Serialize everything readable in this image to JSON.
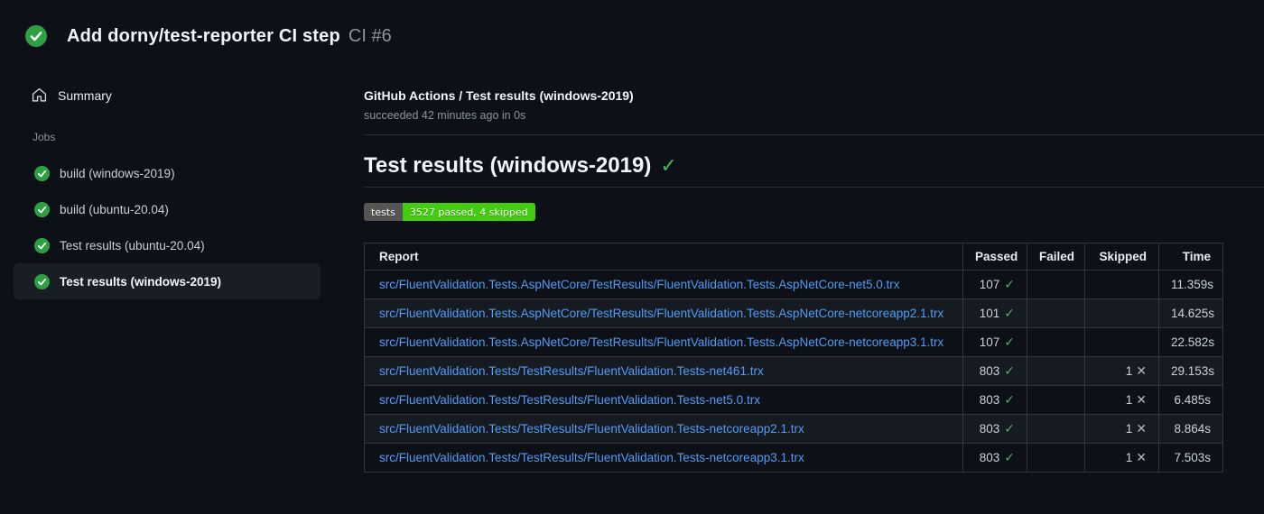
{
  "header": {
    "title": "Add dorny/test-reporter CI step",
    "run_label": "CI #6"
  },
  "sidebar": {
    "summary_label": "Summary",
    "jobs_section_label": "Jobs",
    "jobs": [
      {
        "label": "build (windows-2019)",
        "selected": false
      },
      {
        "label": "build (ubuntu-20.04)",
        "selected": false
      },
      {
        "label": "Test results (ubuntu-20.04)",
        "selected": false
      },
      {
        "label": "Test results (windows-2019)",
        "selected": true
      }
    ]
  },
  "main": {
    "job_title": "GitHub Actions / Test results (windows-2019)",
    "status_line": "succeeded 42 minutes ago in 0s",
    "heading": "Test results (windows-2019)",
    "badge": {
      "label": "tests",
      "value": "3527 passed, 4 skipped"
    },
    "table": {
      "headers": [
        "Report",
        "Passed",
        "Failed",
        "Skipped",
        "Time"
      ],
      "rows": [
        {
          "report": "src/FluentValidation.Tests.AspNetCore/TestResults/FluentValidation.Tests.AspNetCore-net5.0.trx",
          "passed": "107",
          "failed": "",
          "skipped": "",
          "time": "11.359s"
        },
        {
          "report": "src/FluentValidation.Tests.AspNetCore/TestResults/FluentValidation.Tests.AspNetCore-netcoreapp2.1.trx",
          "passed": "101",
          "failed": "",
          "skipped": "",
          "time": "14.625s"
        },
        {
          "report": "src/FluentValidation.Tests.AspNetCore/TestResults/FluentValidation.Tests.AspNetCore-netcoreapp3.1.trx",
          "passed": "107",
          "failed": "",
          "skipped": "",
          "time": "22.582s"
        },
        {
          "report": "src/FluentValidation.Tests/TestResults/FluentValidation.Tests-net461.trx",
          "passed": "803",
          "failed": "",
          "skipped": "1",
          "time": "29.153s"
        },
        {
          "report": "src/FluentValidation.Tests/TestResults/FluentValidation.Tests-net5.0.trx",
          "passed": "803",
          "failed": "",
          "skipped": "1",
          "time": "6.485s"
        },
        {
          "report": "src/FluentValidation.Tests/TestResults/FluentValidation.Tests-netcoreapp2.1.trx",
          "passed": "803",
          "failed": "",
          "skipped": "1",
          "time": "8.864s"
        },
        {
          "report": "src/FluentValidation.Tests/TestResults/FluentValidation.Tests-netcoreapp3.1.trx",
          "passed": "803",
          "failed": "",
          "skipped": "1",
          "time": "7.503s"
        }
      ]
    }
  },
  "icons": {
    "check": "✓",
    "cross": "✕"
  },
  "colors": {
    "page_bg": "#0d1117",
    "row_alt_bg": "#161b22",
    "success_circle": "#2ea043",
    "check_green": "#3fb950",
    "link_blue": "#539bf5",
    "badge_label_bg": "#555555",
    "badge_value_bg": "#44cc11",
    "border": "#30363d"
  }
}
